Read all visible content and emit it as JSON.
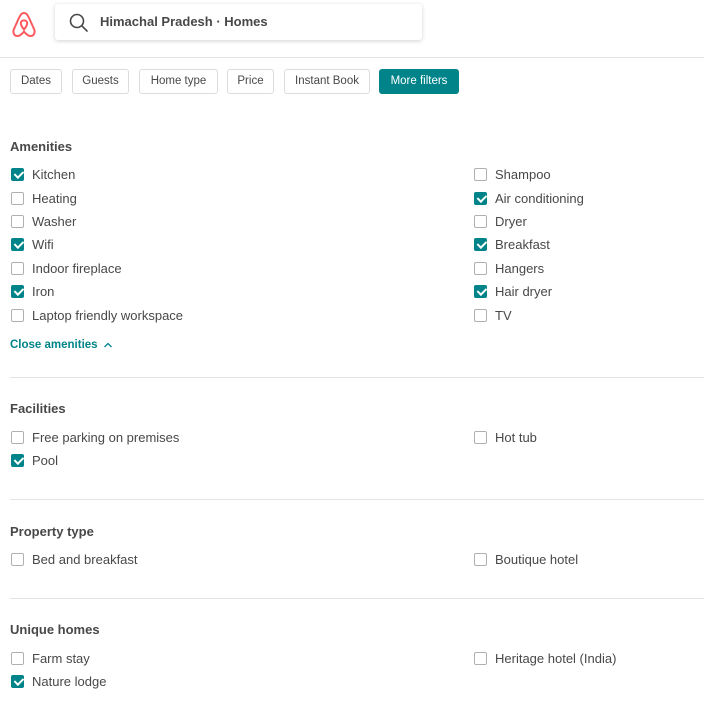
{
  "header": {
    "search_text": "Himachal Pradesh · Homes",
    "brand_color": "#FF5A5F"
  },
  "filters": [
    {
      "label": "Dates",
      "active": false
    },
    {
      "label": "Guests",
      "active": false
    },
    {
      "label": "Home type",
      "active": false
    },
    {
      "label": "Price",
      "active": false
    },
    {
      "label": "Instant Book",
      "active": false
    },
    {
      "label": "More filters",
      "active": true
    }
  ],
  "accent_color": "#008489",
  "amenities": {
    "title": "Amenities",
    "close_label": "Close amenities",
    "left": [
      {
        "label": "Kitchen",
        "checked": true
      },
      {
        "label": "Heating",
        "checked": false
      },
      {
        "label": "Washer",
        "checked": false
      },
      {
        "label": "Wifi",
        "checked": true
      },
      {
        "label": "Indoor fireplace",
        "checked": false
      },
      {
        "label": "Iron",
        "checked": true
      },
      {
        "label": "Laptop friendly workspace",
        "checked": false
      }
    ],
    "right": [
      {
        "label": "Shampoo",
        "checked": false
      },
      {
        "label": "Air conditioning",
        "checked": true
      },
      {
        "label": "Dryer",
        "checked": false
      },
      {
        "label": "Breakfast",
        "checked": true
      },
      {
        "label": "Hangers",
        "checked": false
      },
      {
        "label": "Hair dryer",
        "checked": true
      },
      {
        "label": "TV",
        "checked": false
      }
    ]
  },
  "facilities": {
    "title": "Facilities",
    "left": [
      {
        "label": "Free parking on premises",
        "checked": false
      },
      {
        "label": "Pool",
        "checked": true
      }
    ],
    "right": [
      {
        "label": "Hot tub",
        "checked": false
      }
    ]
  },
  "property_type": {
    "title": "Property type",
    "left": [
      {
        "label": "Bed and breakfast",
        "checked": false
      }
    ],
    "right": [
      {
        "label": "Boutique hotel",
        "checked": false
      }
    ]
  },
  "unique_homes": {
    "title": "Unique homes",
    "left": [
      {
        "label": "Farm stay",
        "checked": false
      },
      {
        "label": "Nature lodge",
        "checked": true
      }
    ],
    "right": [
      {
        "label": "Heritage hotel (India)",
        "checked": false
      }
    ]
  }
}
